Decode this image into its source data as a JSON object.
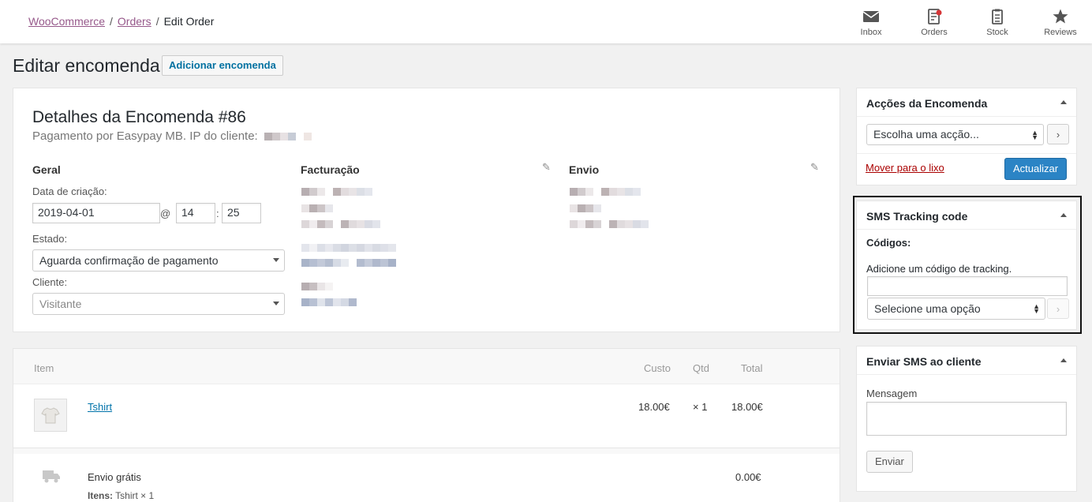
{
  "breadcrumb": {
    "root": "WooCommerce",
    "orders": "Orders",
    "current": "Edit Order",
    "separator": "/"
  },
  "topnav": [
    {
      "label": "Inbox",
      "icon": "inbox-icon"
    },
    {
      "label": "Orders",
      "icon": "orders-icon"
    },
    {
      "label": "Stock",
      "icon": "stock-icon"
    },
    {
      "label": "Reviews",
      "icon": "star-icon"
    }
  ],
  "page": {
    "title": "Editar encomenda",
    "add_button": "Adicionar encomenda"
  },
  "order": {
    "title": "Detalhes da Encomenda #86",
    "subtitle": "Pagamento por Easypay MB. IP do cliente:",
    "general": {
      "heading": "Geral",
      "date_label": "Data de criação:",
      "date": "2019-04-01",
      "at": "@",
      "hour": "14",
      "colon": ":",
      "minute": "25",
      "status_label": "Estado:",
      "status": "Aguarda confirmação de pagamento",
      "customer_label": "Cliente:",
      "customer_placeholder": "Visitante"
    },
    "billing_heading": "Facturação",
    "shipping_heading": "Envio"
  },
  "items": {
    "headers": {
      "item": "Item",
      "cost": "Custo",
      "qty": "Qtd",
      "total": "Total"
    },
    "rows": [
      {
        "name": "Tshirt",
        "cost": "18.00€",
        "qty": "× 1",
        "total": "18.00€"
      }
    ],
    "shipping": {
      "name": "Envio grátis",
      "total": "0.00€",
      "items_label": "Itens:",
      "items_value": "Tshirt × 1"
    }
  },
  "actions_box": {
    "title": "Acções da Encomenda",
    "select": "Escolha uma acção...",
    "go": "›",
    "trash": "Mover para o lixo",
    "update": "Actualizar"
  },
  "sms_tracking": {
    "title": "SMS Tracking code",
    "codes_label": "Códigos:",
    "add_label": "Adicione um código de tracking.",
    "input_value": "",
    "select": "Selecione uma opção",
    "go": "›"
  },
  "send_sms": {
    "title": "Enviar SMS ao cliente",
    "message_label": "Mensagem",
    "message_value": "",
    "send_button": "Enviar"
  }
}
